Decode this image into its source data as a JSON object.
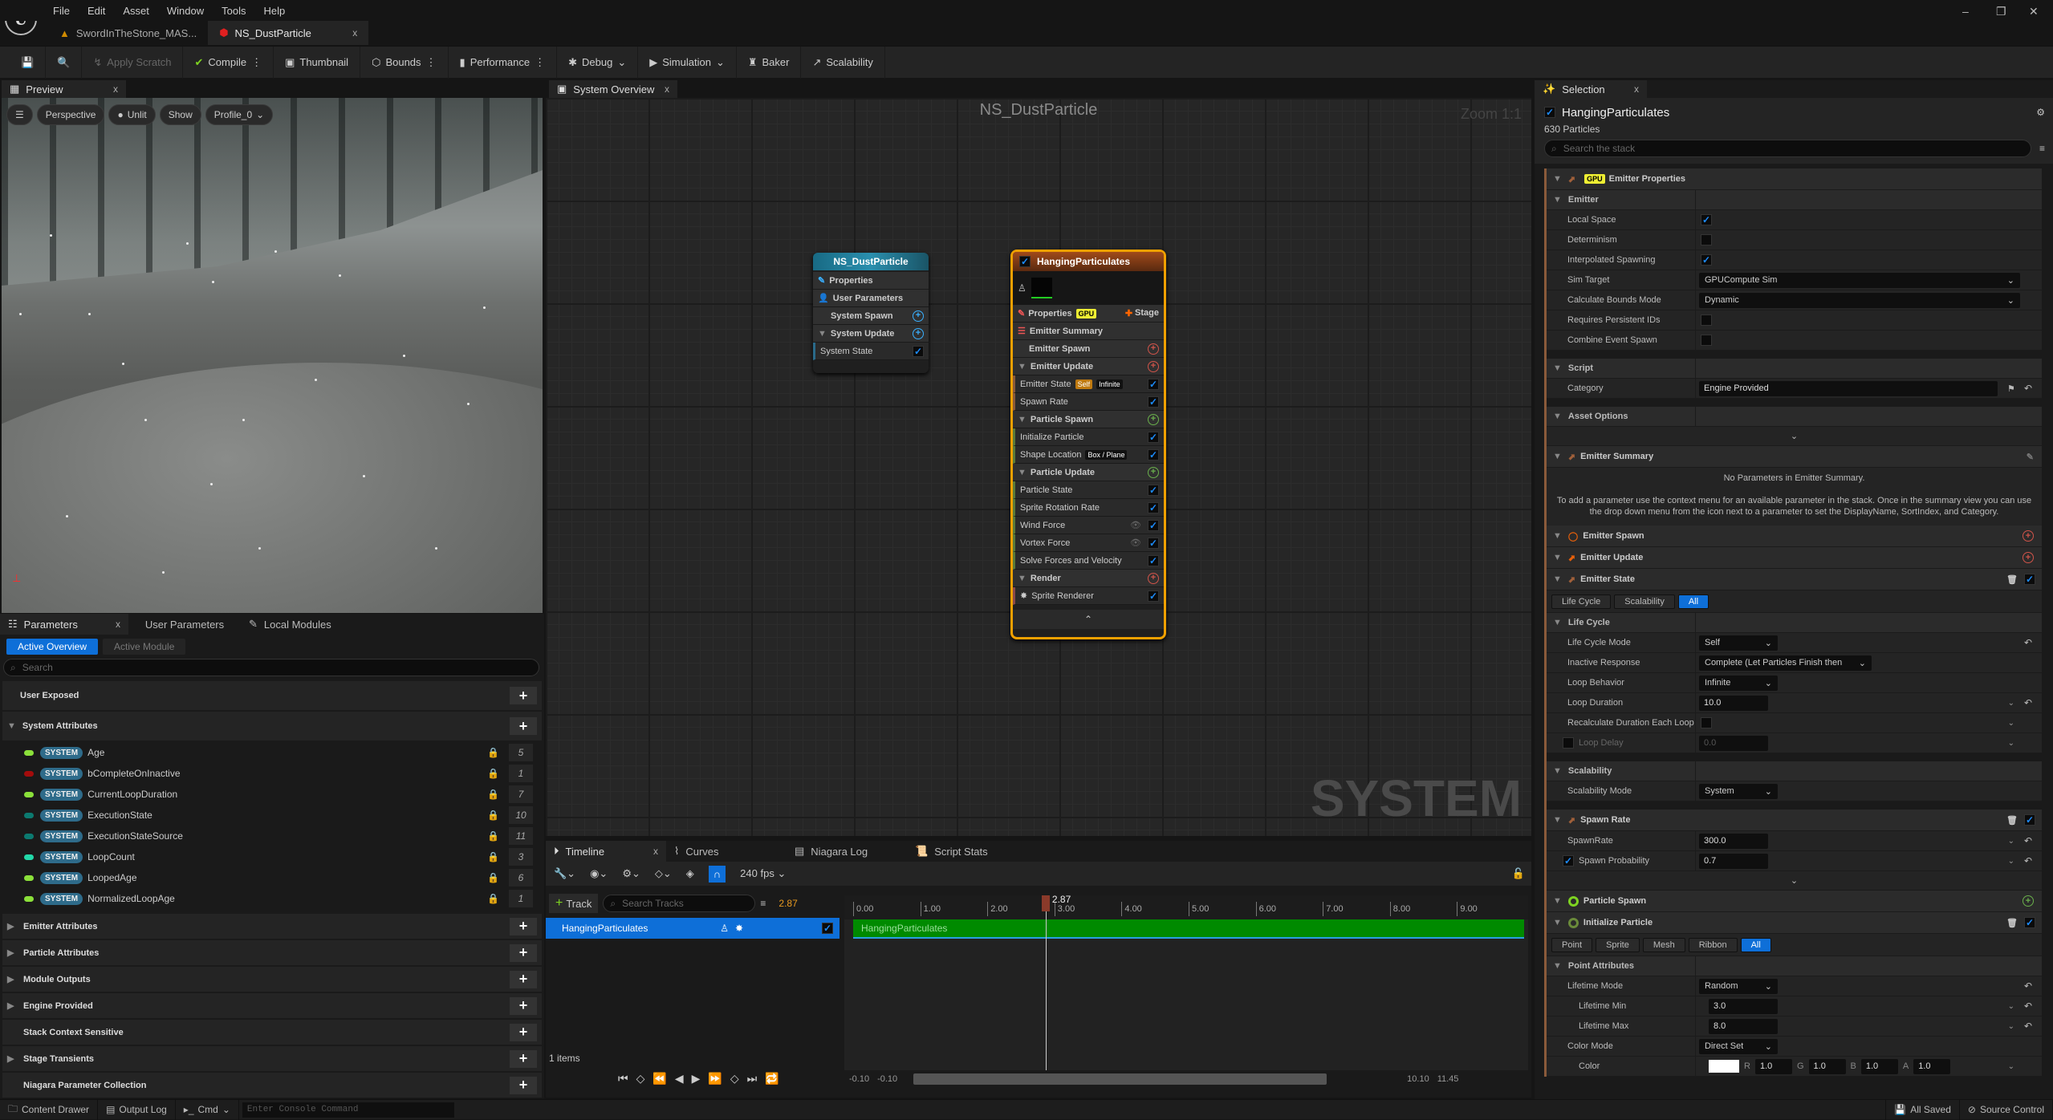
{
  "menu": [
    "File",
    "Edit",
    "Asset",
    "Window",
    "Tools",
    "Help"
  ],
  "doc_tabs": [
    {
      "label": "SwordInTheStone_MAS..."
    },
    {
      "label": "NS_DustParticle",
      "close": "x"
    }
  ],
  "window_controls": [
    "–",
    "❐",
    "✕"
  ],
  "toolbar": {
    "apply_scratch": "Apply Scratch",
    "compile": "Compile",
    "thumbnail": "Thumbnail",
    "bounds": "Bounds",
    "performance": "Performance",
    "debug": "Debug",
    "simulation": "Simulation",
    "baker": "Baker",
    "scalability": "Scalability"
  },
  "preview": {
    "tab": "Preview",
    "close": "x",
    "buttons": {
      "perspective": "Perspective",
      "unlit": "Unlit",
      "show": "Show",
      "profile": "Profile_0"
    }
  },
  "parameters": {
    "tabs": [
      {
        "label": "Parameters"
      },
      {
        "label": "User Parameters"
      },
      {
        "label": "Local Modules"
      }
    ],
    "close": "x",
    "mode": {
      "active": "Active Overview",
      "inactive": "Active Module"
    },
    "search_placeholder": "Search",
    "user_exposed": "User Exposed",
    "system_attributes": "System Attributes",
    "system_tag": "SYSTEM",
    "attributes": [
      {
        "name": "Age",
        "count": "5",
        "color": "#8be03a"
      },
      {
        "name": "bCompleteOnInactive",
        "count": "1",
        "color": "#a30c0c"
      },
      {
        "name": "CurrentLoopDuration",
        "count": "7",
        "color": "#8be03a"
      },
      {
        "name": "ExecutionState",
        "count": "10",
        "color": "#0c7a70"
      },
      {
        "name": "ExecutionStateSource",
        "count": "11",
        "color": "#0c7a70"
      },
      {
        "name": "LoopCount",
        "count": "3",
        "color": "#22d8a8"
      },
      {
        "name": "LoopedAge",
        "count": "6",
        "color": "#8be03a"
      },
      {
        "name": "NormalizedLoopAge",
        "count": "1",
        "color": "#8be03a"
      }
    ],
    "groups": [
      "Emitter Attributes",
      "Particle Attributes",
      "Module Outputs",
      "Engine Provided",
      "Stack Context Sensitive",
      "Stage Transients",
      "Niagara Parameter Collection"
    ]
  },
  "graph": {
    "tab": "System Overview",
    "close": "x",
    "title": "NS_DustParticle",
    "zoom": "Zoom 1:1",
    "watermark": "SYSTEM",
    "system_node": {
      "title": "NS_DustParticle",
      "rows": [
        "Properties",
        "User Parameters",
        "System Spawn",
        "System Update",
        "System State"
      ]
    },
    "emitter_node": {
      "title": "HangingParticulates",
      "properties": "Properties",
      "gpu": "GPU",
      "stage": "Stage",
      "rows": [
        {
          "label": "Emitter Summary",
          "kind": "h"
        },
        {
          "label": "Emitter Spawn",
          "kind": "h",
          "add": "#d2544a"
        },
        {
          "label": "Emitter Update",
          "kind": "h",
          "add": "#d2544a",
          "arrow": true
        },
        {
          "label": "Emitter State",
          "tags": [
            "Self",
            "Infinite"
          ],
          "bar": "#8a5a3a"
        },
        {
          "label": "Spawn Rate",
          "bar": "#8a5a3a"
        },
        {
          "label": "Particle Spawn",
          "kind": "h",
          "add": "#6ab04c",
          "arrow": true
        },
        {
          "label": "Initialize Particle",
          "bar": "#5a7a3a"
        },
        {
          "label": "Shape Location",
          "tags": [
            "Box / Plane"
          ],
          "bar": "#5a7a3a"
        },
        {
          "label": "Particle Update",
          "kind": "h",
          "add": "#6ab04c",
          "arrow": true
        },
        {
          "label": "Particle State",
          "bar": "#5a7a3a"
        },
        {
          "label": "Sprite Rotation Rate",
          "bar": "#5a7a3a"
        },
        {
          "label": "Wind Force",
          "eye": true,
          "bar": "#5a7a3a"
        },
        {
          "label": "Vortex Force",
          "eye": true,
          "bar": "#5a7a3a"
        },
        {
          "label": "Solve Forces and Velocity",
          "bar": "#5a7a3a"
        },
        {
          "label": "Render",
          "kind": "h",
          "add": "#d2544a",
          "arrow": true
        },
        {
          "label": "Sprite Renderer",
          "bar": "#8a4a4a",
          "star": true
        }
      ]
    }
  },
  "timeline": {
    "tabs": [
      {
        "label": "Timeline"
      },
      {
        "label": "Curves"
      },
      {
        "label": "Niagara Log"
      },
      {
        "label": "Script Stats"
      }
    ],
    "close": "x",
    "fps": "240 fps",
    "add_track": "Track",
    "search_placeholder": "Search Tracks",
    "current_time": "2.87",
    "track": "HangingParticulates",
    "ticks": [
      "0.00",
      "1.00",
      "2.00",
      "3.00",
      "4.00",
      "5.00",
      "6.00",
      "7.00",
      "8.00",
      "9.00"
    ],
    "playhead": 2.87,
    "end": 10,
    "items": "1 items",
    "range": {
      "start_a": "-0.10",
      "start_b": "-0.10",
      "end_a": "10.10",
      "end_b": "11.45"
    }
  },
  "selection": {
    "tab": "Selection",
    "close": "x",
    "emitter": "HangingParticulates",
    "particles": "630 Particles",
    "search_placeholder": "Search the stack",
    "rows": [
      {
        "t": "cat",
        "label": "Emitter Properties",
        "icon": "#a0603a",
        "gpu": "GPU"
      },
      {
        "t": "grp",
        "label": "Emitter"
      },
      {
        "t": "prop",
        "label": "Local Space",
        "w": "check",
        "on": true
      },
      {
        "t": "prop",
        "label": "Determinism",
        "w": "check",
        "on": false
      },
      {
        "t": "prop",
        "label": "Interpolated Spawning",
        "w": "check",
        "on": true
      },
      {
        "t": "prop",
        "label": "Sim Target",
        "w": "ddwide",
        "value": "GPUCompute Sim"
      },
      {
        "t": "prop",
        "label": "Calculate Bounds Mode",
        "w": "ddwide",
        "value": "Dynamic"
      },
      {
        "t": "prop",
        "label": "Requires Persistent IDs",
        "w": "check",
        "on": false
      },
      {
        "t": "prop",
        "label": "Combine Event Spawn",
        "w": "check",
        "on": false
      },
      {
        "t": "gap"
      },
      {
        "t": "grp",
        "label": "Script"
      },
      {
        "t": "prop",
        "label": "Category",
        "w": "text",
        "value": "Engine Provided",
        "reset": true
      },
      {
        "t": "gap"
      },
      {
        "t": "grp",
        "label": "Asset Options"
      },
      {
        "t": "exp"
      },
      {
        "t": "cat",
        "label": "Emitter Summary",
        "icon": "#a0603a",
        "edit": true
      },
      {
        "t": "text",
        "title": "No Parameters in Emitter Summary.",
        "body": "To add a parameter use the context menu for an available parameter in the stack. Once in the summary view you can use the drop down menu from the icon next to a parameter to set the DisplayName, SortIndex, and Category."
      },
      {
        "t": "cat",
        "label": "Emitter Spawn",
        "icon": "#e8600a",
        "add": "#d2544a"
      },
      {
        "t": "cat",
        "label": "Emitter Update",
        "icon": "#e8600a",
        "add": "#d2544a"
      },
      {
        "t": "cat",
        "label": "Emitter State",
        "icon": "#a0603a",
        "del": true
      },
      {
        "t": "tabs",
        "items": [
          "Life Cycle",
          "Scalability",
          "All"
        ]
      },
      {
        "t": "grp",
        "label": "Life Cycle"
      },
      {
        "t": "prop",
        "label": "Life Cycle Mode",
        "w": "dd",
        "value": "Self",
        "reset": true
      },
      {
        "t": "prop",
        "label": "Inactive Response",
        "w": "ddmid",
        "value": "Complete (Let Particles Finish then"
      },
      {
        "t": "prop",
        "label": "Loop Behavior",
        "w": "dd",
        "value": "Infinite"
      },
      {
        "t": "prop",
        "label": "Loop Duration",
        "w": "num",
        "value": "10.0",
        "more": true,
        "reset": true
      },
      {
        "t": "prop",
        "label": "Recalculate Duration Each Loop",
        "w": "check",
        "on": false,
        "more": true
      },
      {
        "t": "prop",
        "label": "Loop Delay",
        "w": "num",
        "value": "0.0",
        "more": true,
        "dim": true,
        "lcheck": false
      },
      {
        "t": "gap"
      },
      {
        "t": "grp",
        "label": "Scalability"
      },
      {
        "t": "prop",
        "label": "Scalability Mode",
        "w": "dd",
        "value": "System"
      },
      {
        "t": "gap"
      },
      {
        "t": "cat",
        "label": "Spawn Rate",
        "icon": "#a0603a",
        "del": true
      },
      {
        "t": "prop",
        "label": "SpawnRate",
        "w": "num",
        "value": "300.0",
        "more": true,
        "reset": true
      },
      {
        "t": "prop",
        "label": "Spawn Probability",
        "w": "num",
        "value": "0.7",
        "more": true,
        "reset": true,
        "lcheck": true
      },
      {
        "t": "exp"
      },
      {
        "t": "cat",
        "label": "Particle Spawn",
        "icon": "#7ed321",
        "add": "#6ab04c",
        "ring": true
      },
      {
        "t": "cat",
        "label": "Initialize Particle",
        "icon": "#6a8a3a",
        "del": true,
        "ring": true
      },
      {
        "t": "tabs",
        "items": [
          "Point",
          "Sprite",
          "Mesh",
          "Ribbon",
          "All"
        ]
      },
      {
        "t": "grp",
        "label": "Point Attributes"
      },
      {
        "t": "prop",
        "label": "Lifetime Mode",
        "w": "dd",
        "value": "Random",
        "reset": true
      },
      {
        "t": "prop",
        "label": "Lifetime Min",
        "w": "num",
        "value": "3.0",
        "more": true,
        "reset": true,
        "indent": true
      },
      {
        "t": "prop",
        "label": "Lifetime Max",
        "w": "num",
        "value": "8.0",
        "more": true,
        "reset": true,
        "indent": true
      },
      {
        "t": "prop",
        "label": "Color Mode",
        "w": "dd",
        "value": "Direct Set"
      },
      {
        "t": "prop",
        "label": "Color",
        "w": "color",
        "value": {
          "R": "1.0",
          "G": "1.0",
          "B": "1.0",
          "A": "1.0"
        },
        "more": true,
        "indent": true
      }
    ]
  },
  "status": {
    "content_drawer": "Content Drawer",
    "output_log": "Output Log",
    "cmd": "Cmd",
    "console_placeholder": "Enter Console Command",
    "saved": "All Saved",
    "source_control": "Source Control"
  },
  "colors": {
    "accent": "#0e6fd8",
    "emitter_border": "#f0a000",
    "system_node_header": "#1f6e8a",
    "track_bar": "#008a00"
  }
}
